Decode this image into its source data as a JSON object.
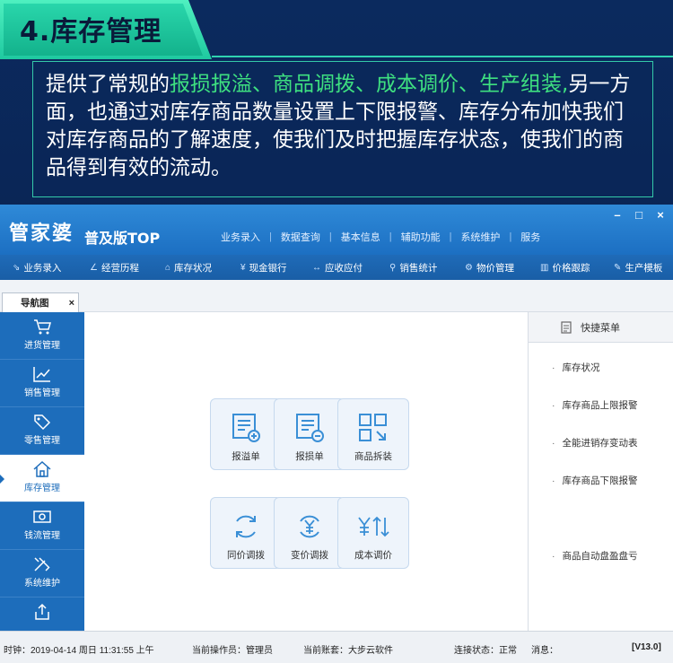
{
  "banner": {
    "title": "4.库存管理",
    "desc_prefix": "提供了常规的",
    "desc_highlight": "报损报溢、商品调拨、成本调价、生产组装,",
    "desc_rest": "另一方面，也通过对库存商品数量设置上下限报警、库存分布加快我们对库存商品的了解速度，使我们及时把握库存状态，使我们的商品得到有效的流动。"
  },
  "colors": {
    "accent_green": "#3ee080",
    "header_blue": "#1d6dbb",
    "banner_teal": "#29d6ab"
  },
  "app": {
    "logo": "管家婆",
    "logo_sub": "普及版TOP",
    "window_controls": [
      "–",
      "□",
      "×"
    ],
    "top_menu": [
      "业务录入",
      "数据查询",
      "基本信息",
      "辅助功能",
      "系统维护",
      "服务"
    ],
    "toolbar": [
      {
        "icon": "entry-icon",
        "glyph": "⇘",
        "label": "业务录入"
      },
      {
        "icon": "chart-icon",
        "glyph": "∠",
        "label": "经营历程"
      },
      {
        "icon": "home-icon",
        "glyph": "⌂",
        "label": "库存状况"
      },
      {
        "icon": "yen-icon",
        "glyph": "¥",
        "label": "现金银行"
      },
      {
        "icon": "swap-icon",
        "glyph": "↔",
        "label": "应收应付"
      },
      {
        "icon": "search-icon",
        "glyph": "⚲",
        "label": "销售统计"
      },
      {
        "icon": "gear-icon",
        "glyph": "⚙",
        "label": "物价管理"
      },
      {
        "icon": "bars-icon",
        "glyph": "▥",
        "label": "价格跟踪"
      },
      {
        "icon": "wrench-icon",
        "glyph": "✎",
        "label": "生产模板"
      }
    ],
    "nav_tab": {
      "label": "导航图",
      "close": "×"
    },
    "sidebar": [
      {
        "label": "进货管理",
        "icon": "cart-icon"
      },
      {
        "label": "销售管理",
        "icon": "trend-icon"
      },
      {
        "label": "零售管理",
        "icon": "tag-icon"
      },
      {
        "label": "库存管理",
        "icon": "house-icon",
        "active": true
      },
      {
        "label": "钱流管理",
        "icon": "money-icon"
      },
      {
        "label": "系统维护",
        "icon": "tools-icon"
      },
      {
        "label": "",
        "icon": "export-icon"
      }
    ],
    "cards": [
      {
        "label": "报溢单",
        "icon": "overflow-doc-icon"
      },
      {
        "label": "报损单",
        "icon": "loss-doc-icon"
      },
      {
        "label": "商品拆装",
        "icon": "assembly-icon"
      },
      {
        "label": "同价调拨",
        "icon": "transfer-icon"
      },
      {
        "label": "变价调拨",
        "icon": "price-transfer-icon"
      },
      {
        "label": "成本调价",
        "icon": "cost-adjust-icon"
      }
    ],
    "quick_menu": {
      "title": "快捷菜单",
      "items": [
        "库存状况",
        "库存商品上限报警",
        "全能进销存变动表",
        "库存商品下限报警",
        "商品自动盘盈盘亏"
      ]
    },
    "statusbar": {
      "time": "时钟：2019-04-14 周日 11:31:55 上午",
      "operator": "当前操作员：管理员",
      "account": "当前账套：大步云软件",
      "connection": "连接状态：正常",
      "message": "消息：",
      "version": "[V13.0]"
    }
  }
}
